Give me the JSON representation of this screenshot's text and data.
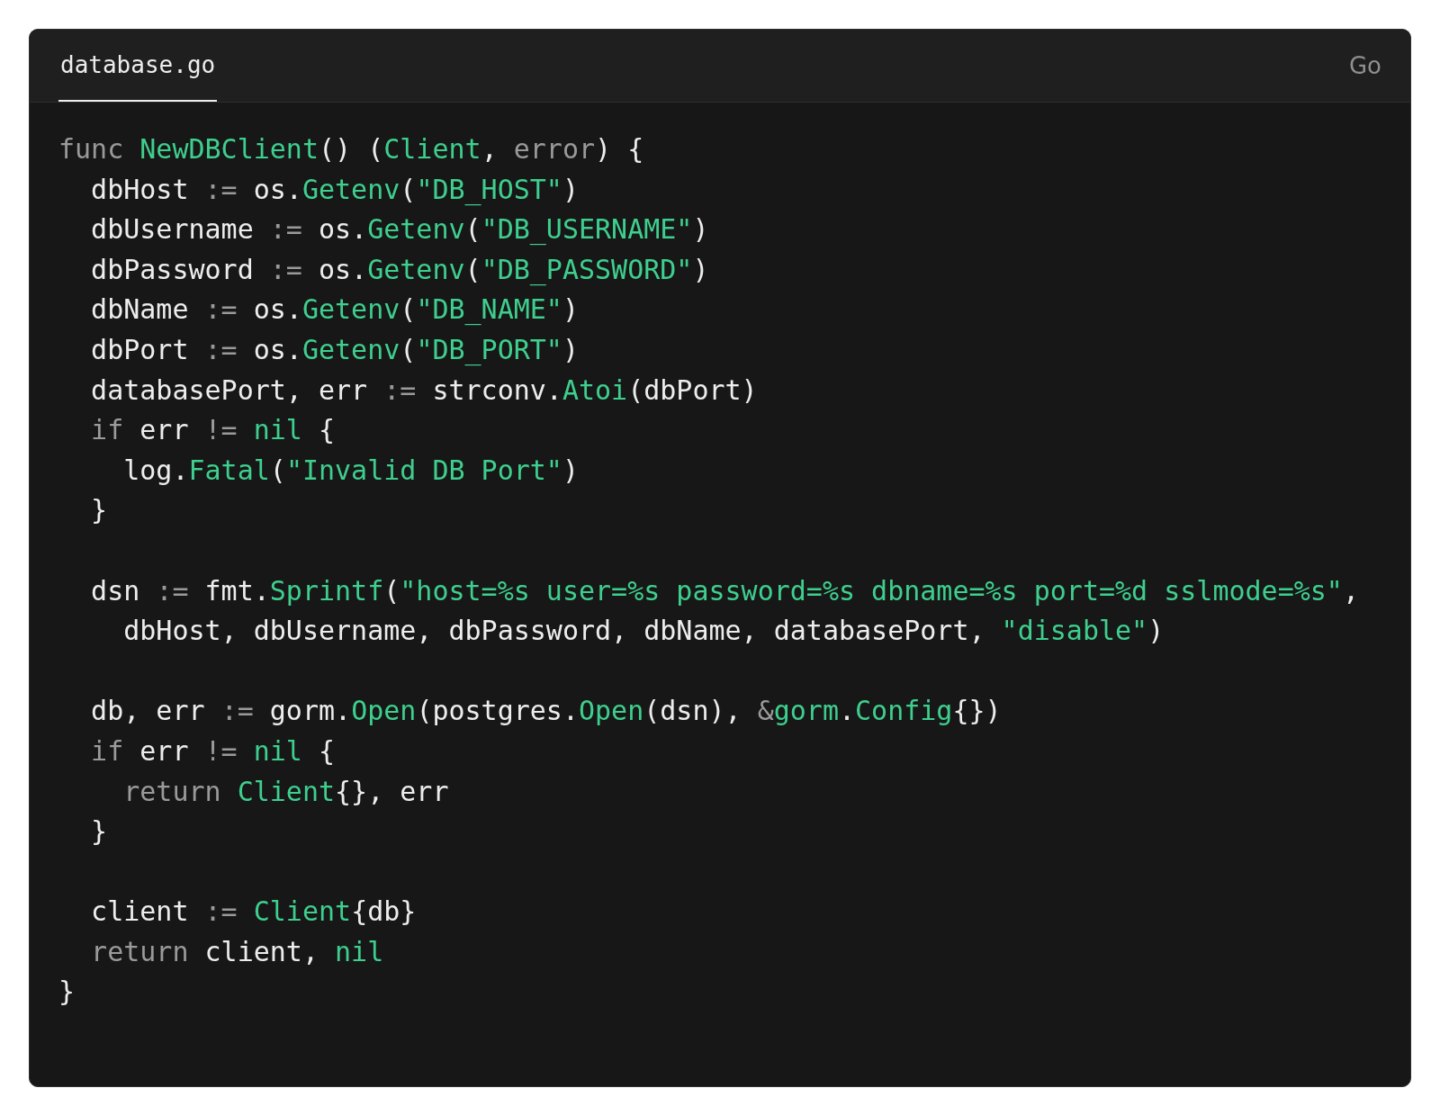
{
  "tabs": [
    {
      "label": "database.go",
      "selected": true
    }
  ],
  "language": "Go",
  "lines": [
    {
      "kind": "code",
      "tokens": [
        {
          "kind": "muted",
          "text": "func "
        },
        {
          "kind": "accent",
          "text": "NewDBClient"
        },
        {
          "kind": "plain",
          "text": "() ("
        },
        {
          "kind": "accent",
          "text": "Client"
        },
        {
          "kind": "plain",
          "text": ", "
        },
        {
          "kind": "muted",
          "text": "error"
        },
        {
          "kind": "plain",
          "text": ") {"
        }
      ]
    },
    {
      "kind": "code",
      "tokens": [
        {
          "kind": "plain",
          "text": "  dbHost "
        },
        {
          "kind": "muted",
          "text": ":="
        },
        {
          "kind": "plain",
          "text": " os."
        },
        {
          "kind": "accent",
          "text": "Getenv"
        },
        {
          "kind": "plain",
          "text": "("
        },
        {
          "kind": "accent",
          "text": "\"DB_HOST\""
        },
        {
          "kind": "plain",
          "text": ")"
        }
      ]
    },
    {
      "kind": "code",
      "tokens": [
        {
          "kind": "plain",
          "text": "  dbUsername "
        },
        {
          "kind": "muted",
          "text": ":="
        },
        {
          "kind": "plain",
          "text": " os."
        },
        {
          "kind": "accent",
          "text": "Getenv"
        },
        {
          "kind": "plain",
          "text": "("
        },
        {
          "kind": "accent",
          "text": "\"DB_USERNAME\""
        },
        {
          "kind": "plain",
          "text": ")"
        }
      ]
    },
    {
      "kind": "code",
      "tokens": [
        {
          "kind": "plain",
          "text": "  dbPassword "
        },
        {
          "kind": "muted",
          "text": ":="
        },
        {
          "kind": "plain",
          "text": " os."
        },
        {
          "kind": "accent",
          "text": "Getenv"
        },
        {
          "kind": "plain",
          "text": "("
        },
        {
          "kind": "accent",
          "text": "\"DB_PASSWORD\""
        },
        {
          "kind": "plain",
          "text": ")"
        }
      ]
    },
    {
      "kind": "code",
      "tokens": [
        {
          "kind": "plain",
          "text": "  dbName "
        },
        {
          "kind": "muted",
          "text": ":="
        },
        {
          "kind": "plain",
          "text": " os."
        },
        {
          "kind": "accent",
          "text": "Getenv"
        },
        {
          "kind": "plain",
          "text": "("
        },
        {
          "kind": "accent",
          "text": "\"DB_NAME\""
        },
        {
          "kind": "plain",
          "text": ")"
        }
      ]
    },
    {
      "kind": "code",
      "tokens": [
        {
          "kind": "plain",
          "text": "  dbPort "
        },
        {
          "kind": "muted",
          "text": ":="
        },
        {
          "kind": "plain",
          "text": " os."
        },
        {
          "kind": "accent",
          "text": "Getenv"
        },
        {
          "kind": "plain",
          "text": "("
        },
        {
          "kind": "accent",
          "text": "\"DB_PORT\""
        },
        {
          "kind": "plain",
          "text": ")"
        }
      ]
    },
    {
      "kind": "code",
      "tokens": [
        {
          "kind": "plain",
          "text": "  databasePort, err "
        },
        {
          "kind": "muted",
          "text": ":="
        },
        {
          "kind": "plain",
          "text": " strconv."
        },
        {
          "kind": "accent",
          "text": "Atoi"
        },
        {
          "kind": "plain",
          "text": "(dbPort)"
        }
      ]
    },
    {
      "kind": "code",
      "tokens": [
        {
          "kind": "muted",
          "text": "  if"
        },
        {
          "kind": "plain",
          "text": " err "
        },
        {
          "kind": "muted",
          "text": "!= "
        },
        {
          "kind": "accent",
          "text": "nil"
        },
        {
          "kind": "plain",
          "text": " {"
        }
      ]
    },
    {
      "kind": "code",
      "tokens": [
        {
          "kind": "plain",
          "text": "    log."
        },
        {
          "kind": "accent",
          "text": "Fatal"
        },
        {
          "kind": "plain",
          "text": "("
        },
        {
          "kind": "accent",
          "text": "\"Invalid DB Port\""
        },
        {
          "kind": "plain",
          "text": ")"
        }
      ]
    },
    {
      "kind": "code",
      "tokens": [
        {
          "kind": "plain",
          "text": "  }"
        }
      ]
    },
    {
      "kind": "blank"
    },
    {
      "kind": "code",
      "tokens": [
        {
          "kind": "plain",
          "text": "  dsn "
        },
        {
          "kind": "muted",
          "text": ":="
        },
        {
          "kind": "plain",
          "text": " fmt."
        },
        {
          "kind": "accent",
          "text": "Sprintf"
        },
        {
          "kind": "plain",
          "text": "("
        },
        {
          "kind": "accent",
          "text": "\"host=%s user=%s password=%s dbname=%s port=%d sslmode=%s\""
        },
        {
          "kind": "plain",
          "text": ","
        }
      ]
    },
    {
      "kind": "code",
      "tokens": [
        {
          "kind": "plain",
          "text": "    dbHost, dbUsername, dbPassword, dbName, databasePort, "
        },
        {
          "kind": "accent",
          "text": "\"disable\""
        },
        {
          "kind": "plain",
          "text": ")"
        }
      ]
    },
    {
      "kind": "blank"
    },
    {
      "kind": "code",
      "tokens": [
        {
          "kind": "plain",
          "text": "  db, err "
        },
        {
          "kind": "muted",
          "text": ":="
        },
        {
          "kind": "plain",
          "text": " gorm."
        },
        {
          "kind": "accent",
          "text": "Open"
        },
        {
          "kind": "plain",
          "text": "(postgres."
        },
        {
          "kind": "accent",
          "text": "Open"
        },
        {
          "kind": "plain",
          "text": "(dsn), "
        },
        {
          "kind": "muted",
          "text": "&"
        },
        {
          "kind": "accent",
          "text": "gorm"
        },
        {
          "kind": "plain",
          "text": "."
        },
        {
          "kind": "accent",
          "text": "Config"
        },
        {
          "kind": "plain",
          "text": "{})"
        }
      ]
    },
    {
      "kind": "code",
      "tokens": [
        {
          "kind": "muted",
          "text": "  if"
        },
        {
          "kind": "plain",
          "text": " err "
        },
        {
          "kind": "muted",
          "text": "!= "
        },
        {
          "kind": "accent",
          "text": "nil"
        },
        {
          "kind": "plain",
          "text": " {"
        }
      ]
    },
    {
      "kind": "code",
      "tokens": [
        {
          "kind": "muted",
          "text": "    return "
        },
        {
          "kind": "accent",
          "text": "Client"
        },
        {
          "kind": "plain",
          "text": "{}, err"
        }
      ]
    },
    {
      "kind": "code",
      "tokens": [
        {
          "kind": "plain",
          "text": "  }"
        }
      ]
    },
    {
      "kind": "blank"
    },
    {
      "kind": "code",
      "tokens": [
        {
          "kind": "plain",
          "text": "  client "
        },
        {
          "kind": "muted",
          "text": ":= "
        },
        {
          "kind": "accent",
          "text": "Client"
        },
        {
          "kind": "plain",
          "text": "{db}"
        }
      ]
    },
    {
      "kind": "code",
      "tokens": [
        {
          "kind": "muted",
          "text": "  return"
        },
        {
          "kind": "plain",
          "text": " client, "
        },
        {
          "kind": "accent",
          "text": "nil"
        }
      ]
    },
    {
      "kind": "code",
      "tokens": [
        {
          "kind": "plain",
          "text": "}"
        }
      ]
    }
  ]
}
